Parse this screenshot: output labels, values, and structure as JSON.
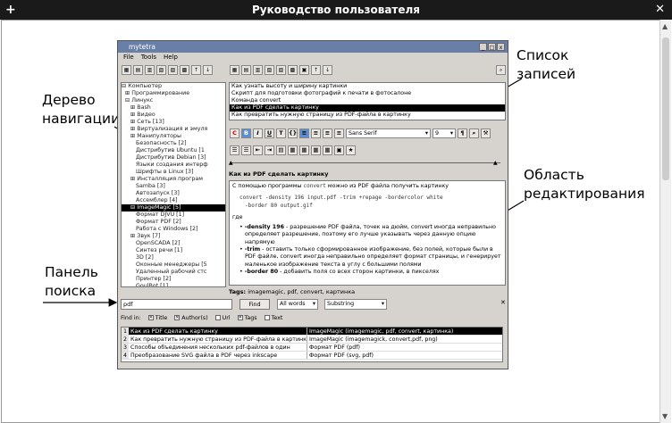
{
  "window": {
    "title": "Руководство пользователя"
  },
  "callouts": {
    "tree": [
      "Дерево",
      "навигации"
    ],
    "records": [
      "Список",
      "записей"
    ],
    "editor": [
      "Область",
      "редактирования"
    ],
    "search": [
      "Панель",
      "поиска"
    ]
  },
  "app": {
    "title": "mytetra",
    "menu": [
      "File",
      "Tools",
      "Help"
    ],
    "tree": [
      "⊟ Компьютер",
      "  ⊞ Программирование",
      "  ⊟ Линукс",
      "     ⊞ Bash",
      "     ⊞ Видео",
      "     ⊞ Сеть [13]",
      "     ⊞ Виртуализация и эмуля",
      "     ⊞ Манипуляторы",
      "        Безопасность [2]",
      "        Дистрибутив Ubuntu [1",
      "        Дистрибутив Debian [3]",
      "        Языки создания интерф",
      "        Шрифты в Linux [3]",
      "     ⊞ Инсталляция програм",
      "        Samba [3]",
      "        Автозапуск [3]",
      "        Ассемблер [4]",
      "     ⊟ ImageMagic [5]",
      "        Формат DJVU [1]",
      "        Формат PDF [2]",
      "        Работа с Windows [2]",
      "     ⊞ Звук [7]",
      "        OpenSCADA [2]",
      "        Синтез речи [1]",
      "        3D [2]",
      "        Оконные менеджеры [5",
      "        Удаленный рабочий стс",
      "        Принтер [2]",
      "        GoulBot [1]"
    ],
    "tree_selected": 17,
    "records": [
      "Как узнать высоту и ширину картинки",
      "Скрипт для подготовки фотографий к печати в фотосалоне",
      "Команда convert",
      "Как из PDF сделать картинку",
      "Как превратить нужную страницу из PDF-файла в картинку"
    ],
    "records_selected": 3,
    "font_combo": "Sans Serif",
    "size_combo": "9",
    "record_title": "Как из PDF сделать картинку",
    "editor": {
      "line1_pre": "С помощью программы ",
      "line1_code": "convert",
      "line1_post": " можно из PDF файла получить картинку",
      "code1": "convert -density 196 input.pdf -trim +repage -bordercolor white",
      "code2": "-border 80 output.gif",
      "gde": "где",
      "b1k": "-density 196",
      "b1": " - разрешение PDF файла, точек на дюйм, convert иногда неправильно определяет разрешение, поэтому его лучше указывать через данную опцию напрямую",
      "b2k": "-trim",
      "b2": " - оставить только сформированное изображение, без полей, которые были в PDF файле, convert иногда неправильно определяет формат страницы, и генерирует маленькое изображение текста в углу с большими полями",
      "b3k": "-border 80",
      "b3": " - добавить поля со всех сторон картинки, в пикселях"
    },
    "tags_label": "Tags:",
    "tags": "imagemagic, pdf, convert, картинка",
    "search": {
      "value": "pdf",
      "find_label": "Find",
      "mode": "All words",
      "match": "Substring",
      "find_in_label": "Find in:",
      "options": [
        {
          "label": "Title",
          "checked": true
        },
        {
          "label": "Author(s)",
          "checked": true
        },
        {
          "label": "Url",
          "checked": false
        },
        {
          "label": "Tags",
          "checked": true
        },
        {
          "label": "Text",
          "checked": false
        }
      ]
    },
    "results": [
      {
        "n": "1",
        "title": "Как из PDF сделать картинку",
        "path": "ImageMagic (imagemagic, pdf, convert, картинка)"
      },
      {
        "n": "2",
        "title": "Как превратить нужную страницу из PDF-файла в картинку",
        "path": "ImageMagic (imagemagick, convert,pdf, png)"
      },
      {
        "n": "3",
        "title": "Способы объединения нескольких pdf-файлов в один",
        "path": "Формат PDF (pdf)"
      },
      {
        "n": "4",
        "title": "Преобразование SVG файла в PDF через inkscape",
        "path": "Формат PDF (svg, pdf)"
      }
    ]
  }
}
